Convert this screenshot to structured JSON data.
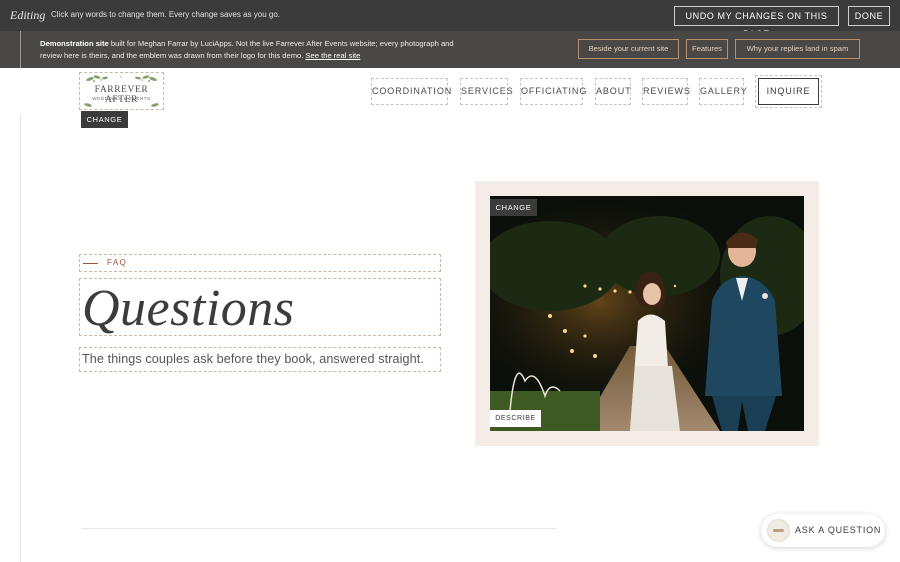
{
  "edit_bar": {
    "mode_label": "Editing",
    "hint": "Click any words to change them. Every change saves as you go.",
    "undo_label": "UNDO MY CHANGES ON THIS PAGE",
    "done_label": "DONE"
  },
  "demo_bar": {
    "lead": "Demonstration site",
    "body": " built for Meghan Farrar by LuciApps. Not the live Farrever After Events website; every photograph and review here is theirs, and the emblem was drawn from their logo for this demo. ",
    "link": "See the real site",
    "buttons": [
      "Beside your current site",
      "Features",
      "Why your replies land in spam"
    ]
  },
  "logo": {
    "title": "FARREVER AFTER",
    "subtitle": "WEDDINGS & EVENTS",
    "change_label": "CHANGE"
  },
  "nav": {
    "items": [
      "COORDINATION",
      "SERVICES",
      "OFFICIATING",
      "ABOUT",
      "REVIEWS",
      "GALLERY"
    ],
    "cta": "INQUIRE"
  },
  "hero": {
    "eyebrow": "FAQ",
    "title": "Questions",
    "subtitle": "The things couples ask before they book, answered straight.",
    "photo_change_label": "CHANGE",
    "photo_describe_label": "DESCRIBE"
  },
  "ask": {
    "label": "ASK A QUESTION"
  },
  "colors": {
    "accent": "#a0553a",
    "bar_dark": "#3b3b3b",
    "card_bg": "#f4ece6"
  }
}
